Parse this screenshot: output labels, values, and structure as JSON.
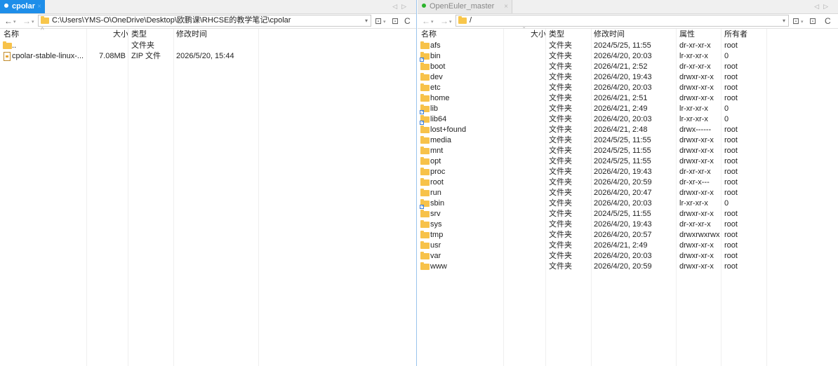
{
  "left": {
    "tab": {
      "label": "cpolar",
      "close": "×"
    },
    "tab_nav": "◁▷",
    "toolbar": {
      "back": "←",
      "forward": "→",
      "dropdown": "▾",
      "bookmark": "⊡",
      "refresh": "C"
    },
    "address": "C:\\Users\\YMS-O\\OneDrive\\Desktop\\欧鹏课\\RHCSE的教学笔记\\cpolar",
    "columns": {
      "name": "名称",
      "size": "大小",
      "type": "类型",
      "modified": "修改时间"
    },
    "rows": [
      {
        "name": "..",
        "size": "",
        "type": "文件夹",
        "modified": "",
        "icon": "folder-icon"
      },
      {
        "name": "cpolar-stable-linux-...",
        "size": "7.08MB",
        "type": "ZIP 文件",
        "modified": "2026/5/20, 15:44",
        "icon": "zip-file-icon"
      }
    ]
  },
  "right": {
    "tab": {
      "label": "OpenEuler_master",
      "close": "×",
      "status_color": "#2bb32b"
    },
    "tab_nav": "◁▷",
    "toolbar": {
      "back": "←",
      "forward": "→",
      "dropdown": "▾",
      "bookmark": "⊡",
      "refresh": "C"
    },
    "address": "/",
    "columns": {
      "name": "名称",
      "size": "大小",
      "type": "类型",
      "modified": "修改时间",
      "attrs": "属性",
      "owner": "所有者"
    },
    "rows": [
      {
        "name": "afs",
        "type": "文件夹",
        "modified": "2024/5/25, 11:55",
        "attrs": "dr-xr-xr-x",
        "owner": "root",
        "link": false
      },
      {
        "name": "bin",
        "type": "文件夹",
        "modified": "2026/4/20, 20:03",
        "attrs": "lr-xr-xr-x",
        "owner": "0",
        "link": true
      },
      {
        "name": "boot",
        "type": "文件夹",
        "modified": "2026/4/21, 2:52",
        "attrs": "dr-xr-xr-x",
        "owner": "root",
        "link": false
      },
      {
        "name": "dev",
        "type": "文件夹",
        "modified": "2026/4/20, 19:43",
        "attrs": "drwxr-xr-x",
        "owner": "root",
        "link": false
      },
      {
        "name": "etc",
        "type": "文件夹",
        "modified": "2026/4/20, 20:03",
        "attrs": "drwxr-xr-x",
        "owner": "root",
        "link": false
      },
      {
        "name": "home",
        "type": "文件夹",
        "modified": "2026/4/21, 2:51",
        "attrs": "drwxr-xr-x",
        "owner": "root",
        "link": false
      },
      {
        "name": "lib",
        "type": "文件夹",
        "modified": "2026/4/21, 2:49",
        "attrs": "lr-xr-xr-x",
        "owner": "0",
        "link": true
      },
      {
        "name": "lib64",
        "type": "文件夹",
        "modified": "2026/4/20, 20:03",
        "attrs": "lr-xr-xr-x",
        "owner": "0",
        "link": true
      },
      {
        "name": "lost+found",
        "type": "文件夹",
        "modified": "2026/4/21, 2:48",
        "attrs": "drwx------",
        "owner": "root",
        "link": false
      },
      {
        "name": "media",
        "type": "文件夹",
        "modified": "2024/5/25, 11:55",
        "attrs": "drwxr-xr-x",
        "owner": "root",
        "link": false
      },
      {
        "name": "mnt",
        "type": "文件夹",
        "modified": "2024/5/25, 11:55",
        "attrs": "drwxr-xr-x",
        "owner": "root",
        "link": false
      },
      {
        "name": "opt",
        "type": "文件夹",
        "modified": "2024/5/25, 11:55",
        "attrs": "drwxr-xr-x",
        "owner": "root",
        "link": false
      },
      {
        "name": "proc",
        "type": "文件夹",
        "modified": "2026/4/20, 19:43",
        "attrs": "dr-xr-xr-x",
        "owner": "root",
        "link": false
      },
      {
        "name": "root",
        "type": "文件夹",
        "modified": "2026/4/20, 20:59",
        "attrs": "dr-xr-x---",
        "owner": "root",
        "link": false
      },
      {
        "name": "run",
        "type": "文件夹",
        "modified": "2026/4/20, 20:47",
        "attrs": "drwxr-xr-x",
        "owner": "root",
        "link": false
      },
      {
        "name": "sbin",
        "type": "文件夹",
        "modified": "2026/4/20, 20:03",
        "attrs": "lr-xr-xr-x",
        "owner": "0",
        "link": true
      },
      {
        "name": "srv",
        "type": "文件夹",
        "modified": "2024/5/25, 11:55",
        "attrs": "drwxr-xr-x",
        "owner": "root",
        "link": false
      },
      {
        "name": "sys",
        "type": "文件夹",
        "modified": "2026/4/20, 19:43",
        "attrs": "dr-xr-xr-x",
        "owner": "root",
        "link": false
      },
      {
        "name": "tmp",
        "type": "文件夹",
        "modified": "2026/4/20, 20:57",
        "attrs": "drwxrwxrwx",
        "owner": "root",
        "link": false
      },
      {
        "name": "usr",
        "type": "文件夹",
        "modified": "2026/4/21, 2:49",
        "attrs": "drwxr-xr-x",
        "owner": "root",
        "link": false
      },
      {
        "name": "var",
        "type": "文件夹",
        "modified": "2026/4/20, 20:03",
        "attrs": "drwxr-xr-x",
        "owner": "root",
        "link": false
      },
      {
        "name": "www",
        "type": "文件夹",
        "modified": "2026/4/20, 20:59",
        "attrs": "drwxr-xr-x",
        "owner": "root",
        "link": false
      }
    ]
  },
  "colors": {
    "accent": "#1e8ee9",
    "folder": "#f7c24a",
    "connected": "#2bb32b"
  }
}
